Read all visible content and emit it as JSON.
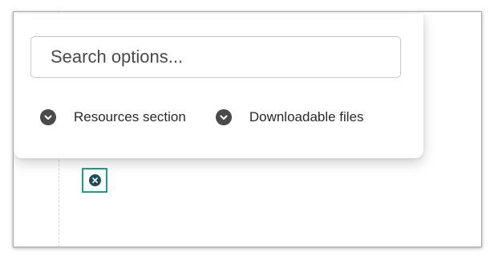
{
  "search": {
    "placeholder": "Search options..."
  },
  "options": [
    {
      "label": "Resources section",
      "icon": "chevron-down-icon"
    },
    {
      "label": "Downloadable files",
      "icon": "chevron-down-icon"
    }
  ],
  "clear_button": {
    "icon": "close-circle-icon"
  },
  "colors": {
    "highlight_border": "#1a9e85",
    "clear_icon_fill": "#1f4e57",
    "chevron_fill": "#4a4a4a"
  }
}
